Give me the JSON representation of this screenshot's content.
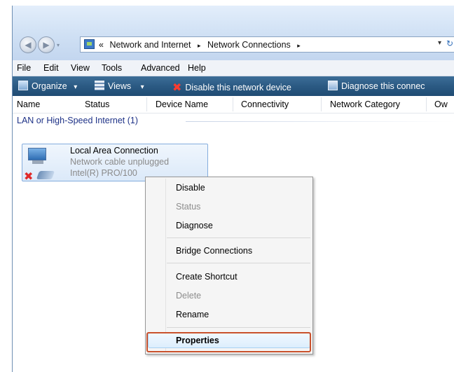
{
  "address_bar": {
    "crumb_prefix": "«",
    "crumbs": [
      "Network and Internet",
      "Network Connections"
    ],
    "separator": "▸",
    "back_glyph": "◀",
    "forward_glyph": "▶",
    "dropdown_glyph": "▾",
    "refresh_glyph": "↻"
  },
  "menubar": {
    "items": [
      "File",
      "Edit",
      "View",
      "Tools",
      "Advanced",
      "Help"
    ]
  },
  "toolbar": {
    "organize": "Organize",
    "views": "Views",
    "dropdown_glyph": "▾",
    "disable": "Disable this network device",
    "disable_icon": "✖",
    "diagnose": "Diagnose this connec"
  },
  "columns": [
    "Name",
    "Status",
    "Device Name",
    "Connectivity",
    "Network Category",
    "Ow"
  ],
  "group": {
    "label": "LAN or High-Speed Internet (1)"
  },
  "connection": {
    "name": "Local Area Connection",
    "status": "Network cable unplugged",
    "device": "Intel(R) PRO/100",
    "error_glyph": "✖"
  },
  "context_menu": {
    "items": [
      {
        "label": "Disable",
        "enabled": true
      },
      {
        "label": "Status",
        "enabled": false
      },
      {
        "label": "Diagnose",
        "enabled": true
      },
      {
        "label": "Bridge Connections",
        "enabled": true
      },
      {
        "label": "Create Shortcut",
        "enabled": true
      },
      {
        "label": "Delete",
        "enabled": false
      },
      {
        "label": "Rename",
        "enabled": true
      },
      {
        "label": "Properties",
        "enabled": true,
        "default": true,
        "highlighted": true
      }
    ]
  },
  "colors": {
    "toolbar": "#2b5a83",
    "group_text": "#1e3287",
    "highlight_box": "#c9512c",
    "error": "#e02a2a"
  }
}
